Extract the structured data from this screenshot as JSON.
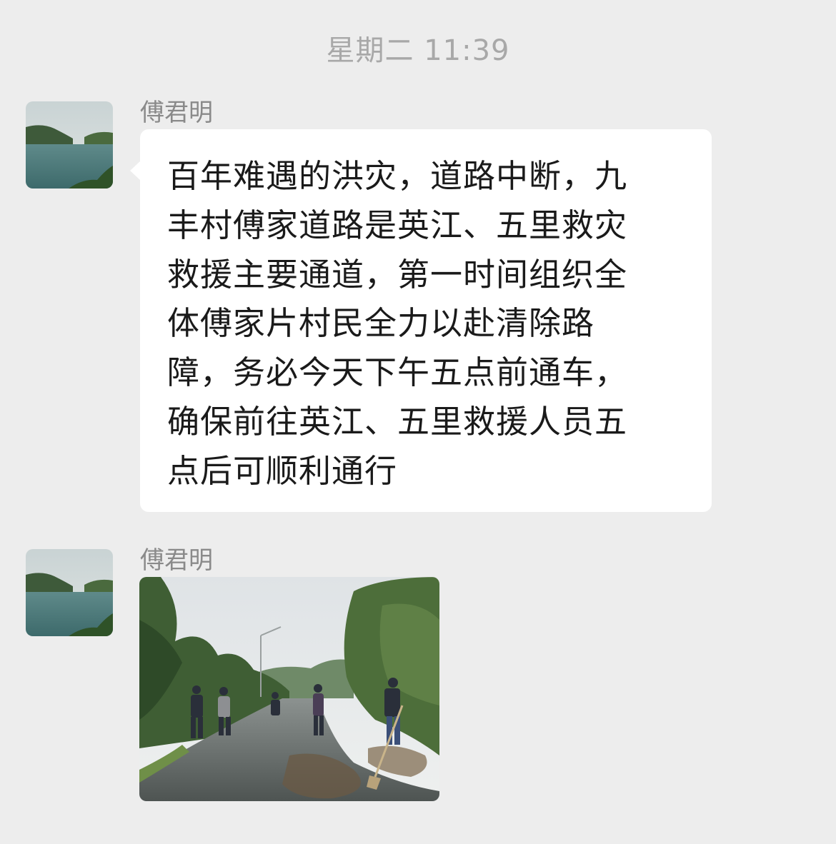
{
  "timestamp": "星期二 11:39",
  "messages": [
    {
      "sender": "傅君明",
      "avatar_icon": "lake-landscape-avatar",
      "text_lines": [
        "百年难遇的洪灾，道路中断，九",
        "丰村傅家道路是英江、五里救灾",
        "救援主要通道，第一时间组织全",
        "体傅家片村民全力以赴清除路",
        "障，务必今天下午五点前通车，",
        "确保前往英江、五里救援人员五",
        "点后可顺利通行"
      ]
    },
    {
      "sender": "傅君明",
      "avatar_icon": "lake-landscape-avatar",
      "image_icon": "road-clearing-photo"
    }
  ],
  "colors": {
    "background": "#ededed",
    "bubble": "#ffffff",
    "text": "#1a1a1a",
    "meta_text": "#a8a8a8"
  }
}
